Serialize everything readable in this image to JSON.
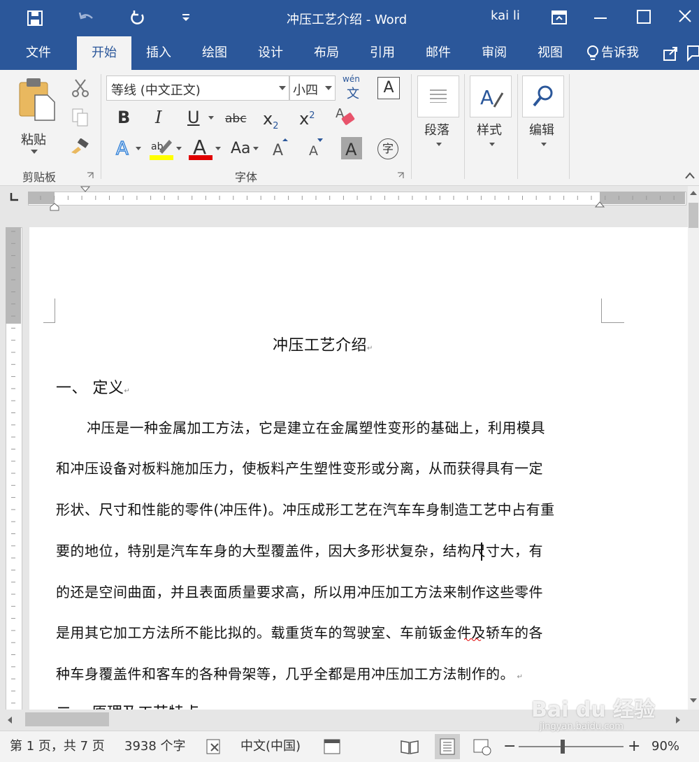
{
  "window": {
    "title": "冲压工艺介绍  -  Word",
    "user": "kai li"
  },
  "tabs": [
    "文件",
    "开始",
    "插入",
    "绘图",
    "设计",
    "布局",
    "引用",
    "邮件",
    "审阅",
    "视图"
  ],
  "tell_me": "告诉我",
  "ribbon": {
    "clipboard": {
      "paste": "粘贴",
      "group": "剪贴板"
    },
    "font": {
      "name": "等线 (中文正文)",
      "size": "小四",
      "group": "字体",
      "wen": "wén",
      "wen_char": "文",
      "bold": "B",
      "italic": "I",
      "underline": "U",
      "strike": "abc",
      "sub": "x",
      "sub_s": "2",
      "sup": "x",
      "sup_s": "2",
      "aa": "Aa",
      "char_border": "A",
      "phonetic": "字"
    },
    "paragraph": "段落",
    "styles": "样式",
    "editing": "编辑"
  },
  "document": {
    "title": "冲压工艺介绍",
    "heading1": "一、  定义",
    "lines": [
      "冲压是一种金属加工方法，它是建立在金属塑性变形的基础上，利用模具",
      "和冲压设备对板料施加压力，使板料产生塑性变形或分离，从而获得具有一定",
      "形状、尺寸和性能的零件(冲压件)。冲压成形工艺在汽车车身制造工艺中占有重",
      "要的地位，特别是汽车车身的大型覆盖件，因大多形状复杂，结构尺寸大，有",
      "的还是空间曲面，并且表面质量要求高，所以用冲压加工方法来制作这些零件",
      "是用其它加工方法所不能比拟的。载重货车的驾驶室、车前钣金件及轿车的各",
      "种车身覆盖件和客车的各种骨架等，几乎全都是用冲压加工方法制作的。"
    ],
    "heading2_partial": "二、  原理及工艺特点"
  },
  "status": {
    "page": "第 1 页，共 7 页",
    "words": "3938 个字",
    "language": "中文(中国)",
    "zoom": "90%"
  },
  "watermark": {
    "brand": "Bai du 经验",
    "url": "jingyan.baidu.com"
  },
  "colors": {
    "accent": "#2b579a",
    "highlight": "#ffff00",
    "font_color": "#e00000"
  }
}
